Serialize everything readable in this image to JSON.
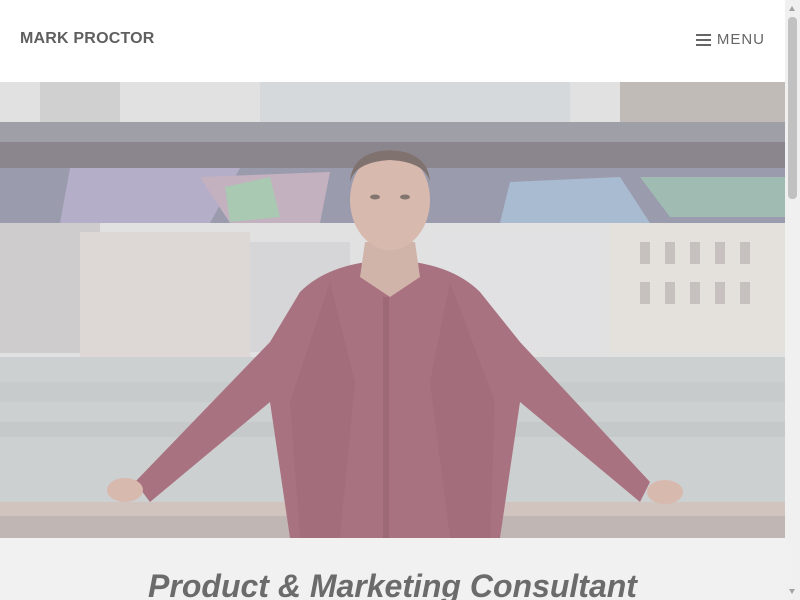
{
  "header": {
    "site_title": "MARK PROCTOR",
    "menu_label": "MENU",
    "menu_icon": "hamburger-icon"
  },
  "hero": {
    "image_subject": "portrait-photo"
  },
  "intro": {
    "tagline": "Product & Marketing Consultant"
  },
  "colors": {
    "header_bg": "#ffffff",
    "title_text": "#5f5f5f",
    "tagline_text": "#6b6b6b",
    "intro_bg": "#f1f1f1",
    "shirt": "#9a5a6a"
  }
}
